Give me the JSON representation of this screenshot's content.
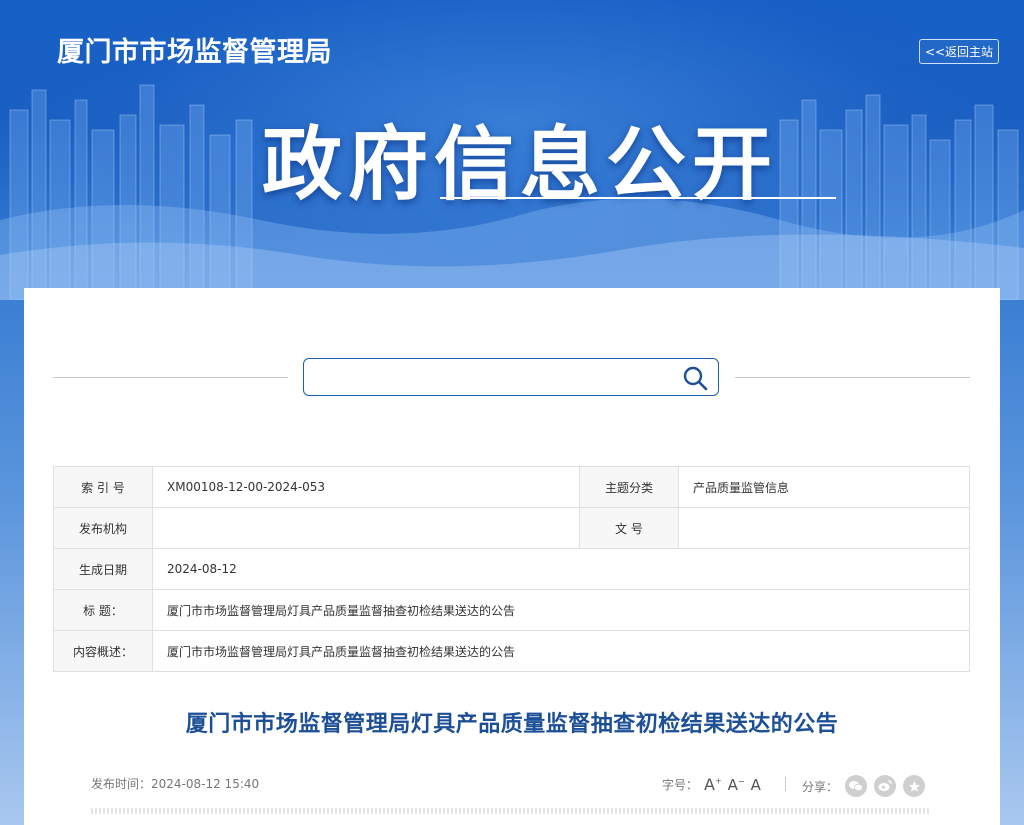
{
  "header": {
    "site_title": "厦门市市场监督管理局",
    "back_label": "<<返回主站",
    "hero_title": "政府信息公开"
  },
  "search": {
    "placeholder": "",
    "value": ""
  },
  "info_table": {
    "index_label": "索 引 号",
    "index_value": "XM00108-12-00-2024-053",
    "topic_label": "主题分类",
    "topic_value": "产品质量监管信息",
    "publisher_label": "发布机构",
    "publisher_value": "",
    "doc_no_label": "文    号",
    "doc_no_value": "",
    "date_label": "生成日期",
    "date_value": "2024-08-12",
    "title_label": "标    题：",
    "title_value": "厦门市市场监督管理局灯具产品质量监督抽查初检结果送达的公告",
    "summary_label": "内容概述：",
    "summary_value": "厦门市市场监督管理局灯具产品质量监督抽查初检结果送达的公告"
  },
  "article": {
    "title": "厦门市市场监督管理局灯具产品质量监督抽查初检结果送达的公告",
    "publish_time": "发布时间：2024-08-12 15:40",
    "font_size_label": "字号：",
    "font_large": "A",
    "font_medium": "A",
    "font_small": "A",
    "share_label": "分享："
  },
  "icons": {
    "search": "search-icon",
    "wechat": "wechat-icon",
    "weibo": "weibo-icon",
    "favorite": "star-icon"
  },
  "colors": {
    "banner_blue": "#1660c6",
    "title_blue": "#1c4f96",
    "search_border": "#1e5fb5"
  }
}
